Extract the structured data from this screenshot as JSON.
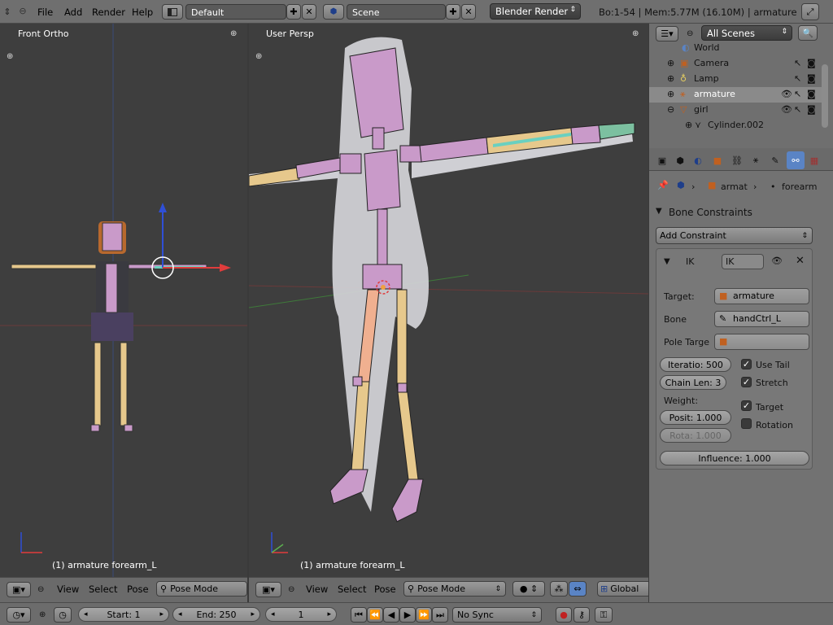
{
  "topbar": {
    "menus": [
      "File",
      "Add",
      "Render",
      "Help"
    ],
    "layout": "Default",
    "scene": "Scene",
    "engine": "Blender Render",
    "stats": "Bo:1-54  | Mem:5.77M (16.10M) | armature"
  },
  "viewport_left": {
    "label": "Front Ortho",
    "footer": "(1) armature forearm_L",
    "menus": [
      "View",
      "Select",
      "Pose"
    ],
    "mode": "Pose Mode"
  },
  "viewport_right": {
    "label": "User Persp",
    "footer": "(1) armature forearm_L",
    "menus": [
      "View",
      "Select",
      "Pose"
    ],
    "mode": "Pose Mode",
    "orientation": "Global"
  },
  "outliner": {
    "filter": "All Scenes",
    "items": [
      {
        "label": "World",
        "icon": "world-icon"
      },
      {
        "label": "Camera",
        "icon": "camera-icon"
      },
      {
        "label": "Lamp",
        "icon": "lamp-icon"
      },
      {
        "label": "armature",
        "icon": "armature-icon"
      },
      {
        "label": "girl",
        "icon": "mesh-icon"
      },
      {
        "label": "Cylinder.002",
        "icon": "mesh-data-icon"
      }
    ]
  },
  "properties": {
    "breadcrumb": [
      "armat",
      "forearm"
    ],
    "section_title": "Bone Constraints",
    "add_constraint": "Add Constraint",
    "constraint": {
      "type_label": "IK",
      "name": "IK",
      "target_label": "Target:",
      "target_value": "armature",
      "bone_label": "Bone",
      "bone_value": "handCtrl_L",
      "pole_label": "Pole Targe",
      "iterations": "Iteratio: 500",
      "chain_len": "Chain Len: 3",
      "use_tail": "Use Tail",
      "stretch": "Stretch",
      "weight_label": "Weight:",
      "target_chk": "Target",
      "rotation_chk": "Rotation",
      "position": "Posit: 1.000",
      "rotation": "Rota: 1.000",
      "influence": "Influence: 1.000"
    }
  },
  "timeline": {
    "start": "Start: 1",
    "end": "End: 250",
    "current": "1",
    "sync": "No Sync"
  },
  "colors": {
    "viewport_bg": "#3e3e3e",
    "bone_pink": "#c99ac9",
    "bone_tan": "#e6c88c",
    "x_axis": "#e03c3c",
    "y_axis": "#5cb050",
    "z_axis": "#2f4fd6",
    "selection_blue": "#5a84c5"
  }
}
